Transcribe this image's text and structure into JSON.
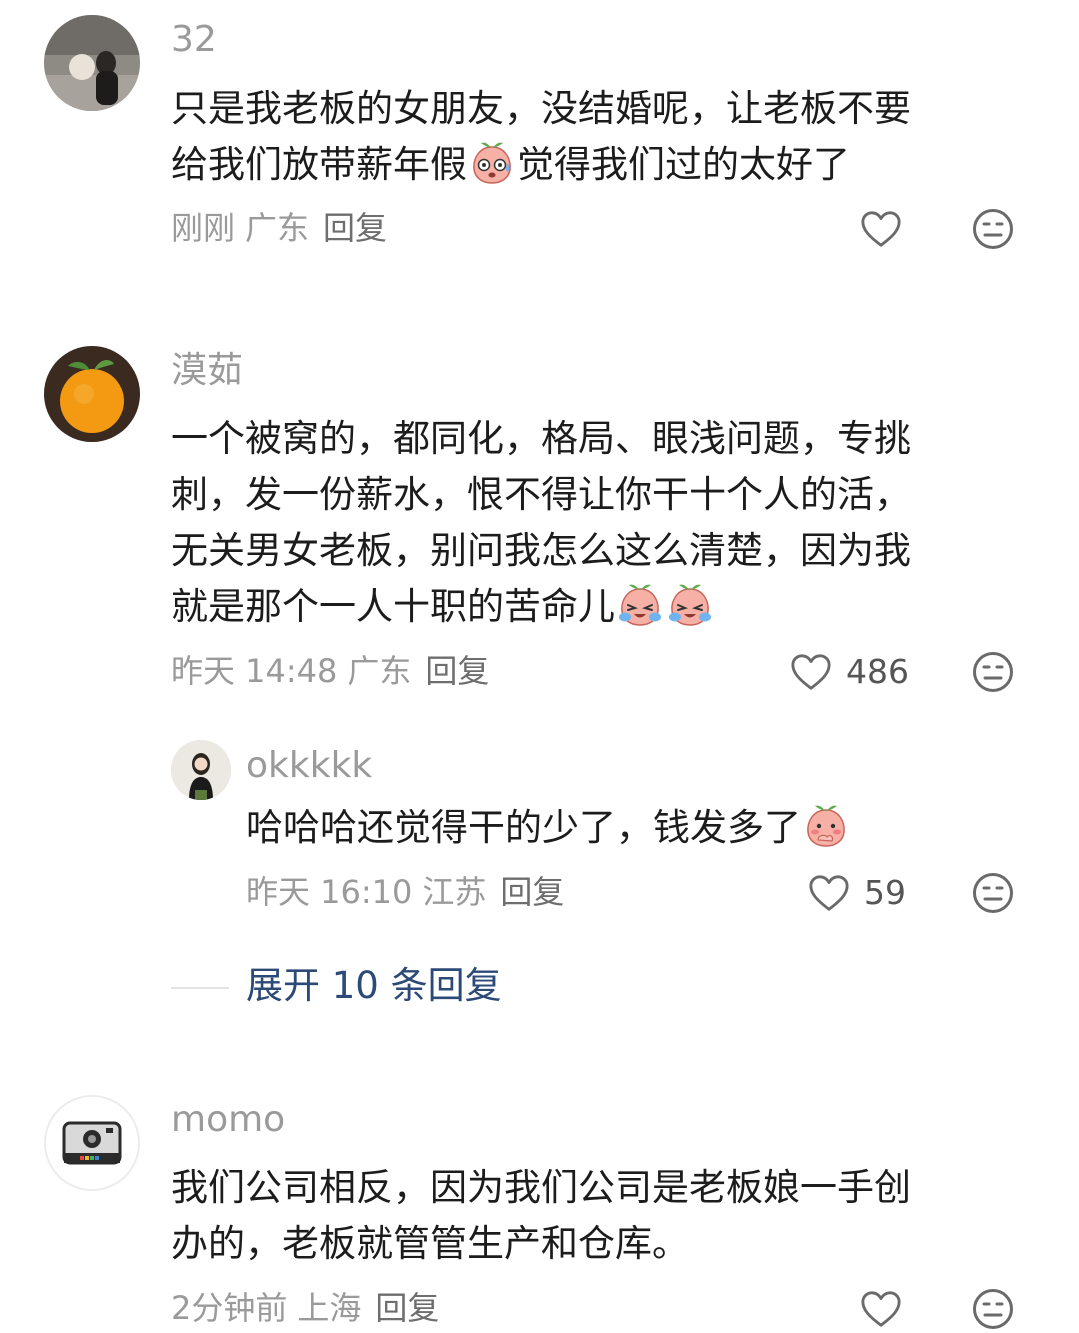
{
  "comments": [
    {
      "username": "32",
      "lines": [
        "只是我老板的女朋友，没结婚呢，让老板不要",
        "给我们放带薪年假",
        "觉得我们过的太好了"
      ],
      "time": "刚刚",
      "location": "广东",
      "reply_label": "回复",
      "likes": ""
    },
    {
      "username": "漠茹",
      "lines": [
        "一个被窝的，都同化，格局、眼浅问题，专挑",
        "刺，发一份薪水，恨不得让你干十个人的活，",
        "无关男女老板，别问我怎么这么清楚，因为我",
        "就是那个一人十职的苦命儿"
      ],
      "time": "昨天 14:48",
      "location": "广东",
      "reply_label": "回复",
      "likes": "486",
      "sub_reply": {
        "username": "okkkkk",
        "text": "哈哈哈还觉得干的少了，钱发多了",
        "time": "昨天 16:10",
        "location": "江苏",
        "reply_label": "回复",
        "likes": "59"
      },
      "expand_label": "展开 10 条回复"
    },
    {
      "username": "momo",
      "lines": [
        "我们公司相反，因为我们公司是老板娘一手创",
        "办的，老板就管管生产和仓库。"
      ],
      "time": "2分钟前",
      "location": "上海",
      "reply_label": "回复",
      "likes": ""
    }
  ],
  "icons": {
    "like": "heart-outline-icon",
    "dislike": "meh-face-icon",
    "emoji_sweat": "peach-sweat-emoji",
    "emoji_cry": "peach-cry-emoji",
    "emoji_shy": "peach-shy-emoji"
  },
  "colors": {
    "meta": "#9a9a9a",
    "expand": "#2c4a78",
    "icon": "#6a6a6a"
  }
}
